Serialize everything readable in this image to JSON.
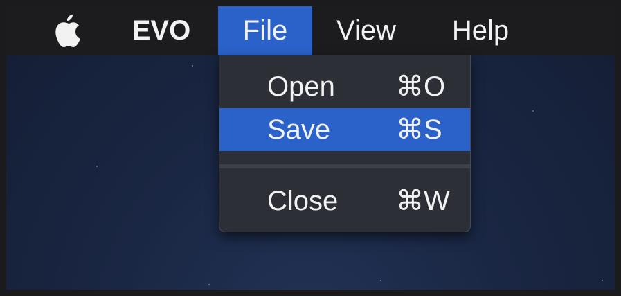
{
  "menubar": {
    "apple_icon": "apple-icon",
    "app_name": "EVO",
    "menus": [
      {
        "label": "File",
        "active": true
      },
      {
        "label": "View",
        "active": false
      },
      {
        "label": "Help",
        "active": false
      }
    ]
  },
  "file_menu": {
    "items": [
      {
        "label": "Open",
        "shortcut": "⌘O",
        "highlighted": false
      },
      {
        "label": "Save",
        "shortcut": "⌘S",
        "highlighted": true
      },
      {
        "label": "Close",
        "shortcut": "⌘W",
        "highlighted": false
      }
    ]
  },
  "colors": {
    "menubar_bg": "#1c1c1f",
    "highlight": "#2a62c9",
    "dropdown_bg": "#2c2f36",
    "desktop_bg": "#1a2744",
    "text": "#f2f2f2"
  }
}
